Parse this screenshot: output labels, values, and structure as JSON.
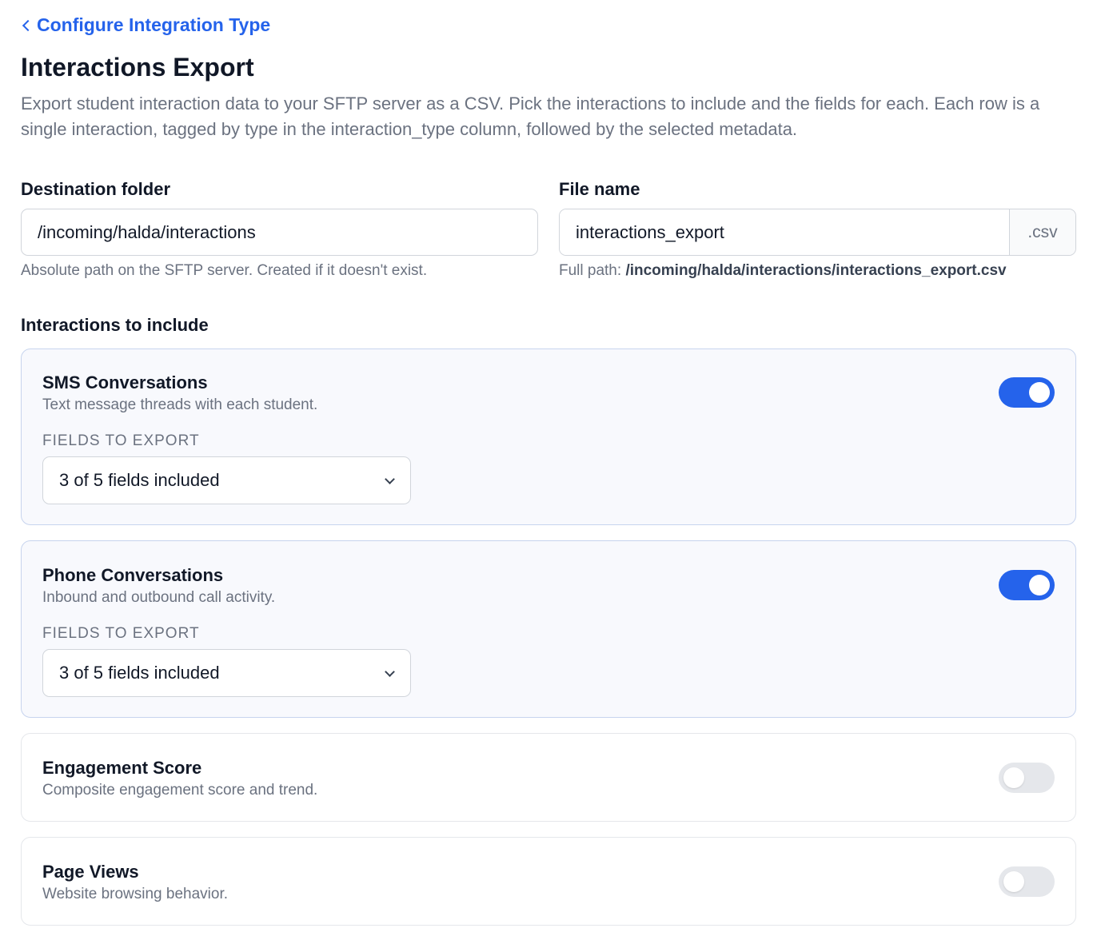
{
  "header": {
    "back_label": "Configure Integration Type",
    "title": "Interactions Export",
    "description": "Export student interaction data to your SFTP server as a CSV. Pick the interactions to include and the fields for each. Each row is a single interaction, tagged by type in the interaction_type column, followed by the selected metadata."
  },
  "destination": {
    "label": "Destination folder",
    "value": "/incoming/halda/interactions",
    "help": "Absolute path on the SFTP server. Created if it doesn't exist."
  },
  "file": {
    "label": "File name",
    "value": "interactions_export",
    "suffix": ".csv",
    "full_path_prefix": "Full path:",
    "full_path": "/incoming/halda/interactions/interactions_export.csv"
  },
  "interactions": {
    "label": "Interactions to include",
    "fields_label": "FIELDS TO EXPORT",
    "items": [
      {
        "title": "SMS Conversations",
        "description": "Text message threads with each student.",
        "enabled": true,
        "fields_summary": "3 of 5 fields included"
      },
      {
        "title": "Phone Conversations",
        "description": "Inbound and outbound call activity.",
        "enabled": true,
        "fields_summary": "3 of 5 fields included"
      },
      {
        "title": "Engagement Score",
        "description": "Composite engagement score and trend.",
        "enabled": false
      },
      {
        "title": "Page Views",
        "description": "Website browsing behavior.",
        "enabled": false
      }
    ]
  },
  "colors": {
    "accent": "#2563eb",
    "toggle_off": "#e5e7eb",
    "active_card_bg": "#f8f9fd"
  }
}
